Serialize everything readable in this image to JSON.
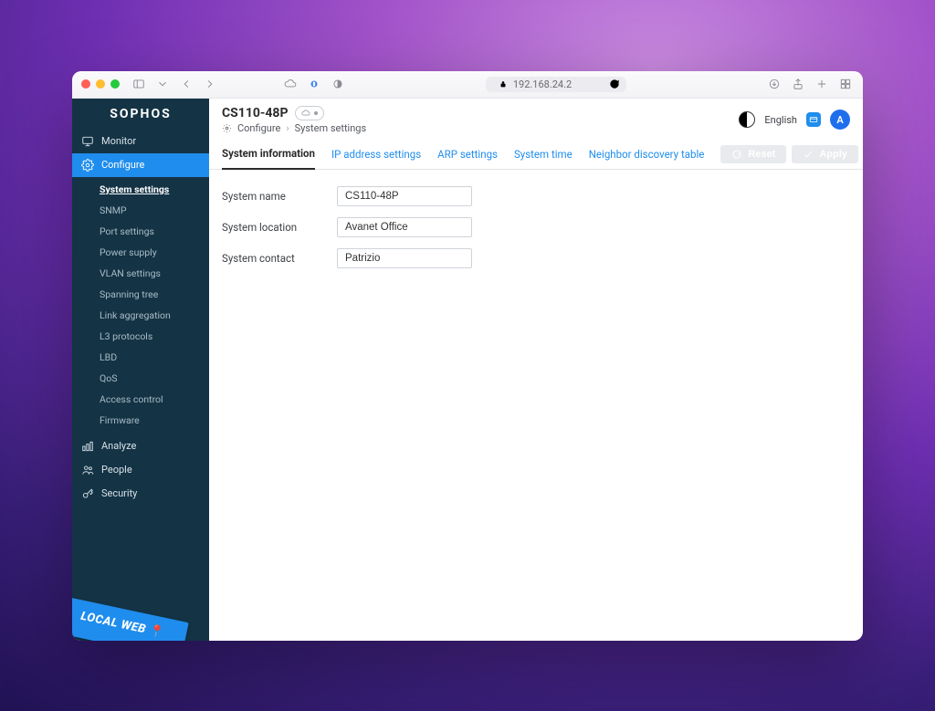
{
  "browser": {
    "address": "192.168.24.2"
  },
  "brand": "SOPHOS",
  "nav": {
    "monitor": "Monitor",
    "configure": "Configure",
    "analyze": "Analyze",
    "people": "People",
    "security": "Security"
  },
  "configure_sub": [
    "System settings",
    "SNMP",
    "Port settings",
    "Power supply",
    "VLAN settings",
    "Spanning tree",
    "Link aggregation",
    "L3 protocols",
    "LBD",
    "QoS",
    "Access control",
    "Firmware"
  ],
  "local_web": "LOCAL WEB",
  "header": {
    "device": "CS110-48P",
    "crumb_root": "Configure",
    "crumb_leaf": "System settings",
    "language": "English",
    "avatar_initial": "A"
  },
  "tabs": [
    "System information",
    "IP address settings",
    "ARP settings",
    "System time",
    "Neighbor discovery table"
  ],
  "actions": {
    "reset": "Reset",
    "apply": "Apply"
  },
  "form": {
    "name_label": "System name",
    "name_value": "CS110-48P",
    "location_label": "System location",
    "location_value": "Avanet Office",
    "contact_label": "System contact",
    "contact_value": "Patrizio"
  }
}
